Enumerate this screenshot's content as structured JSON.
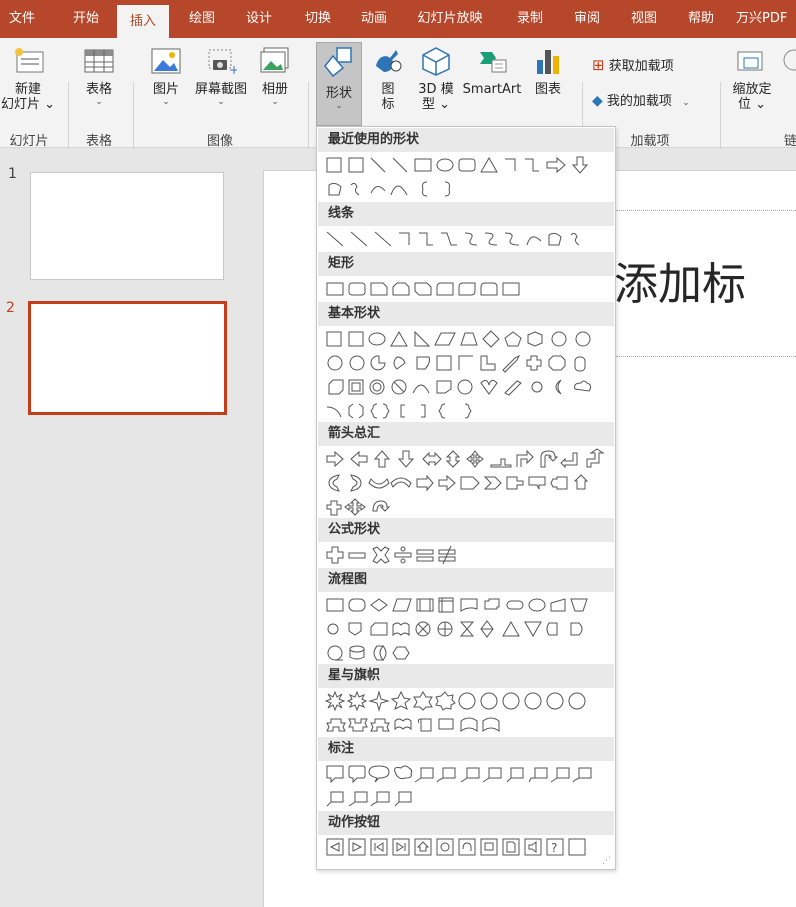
{
  "tabs": [
    {
      "label": "文件",
      "active": false
    },
    {
      "label": "开始",
      "active": false
    },
    {
      "label": "插入",
      "active": true
    },
    {
      "label": "绘图",
      "active": false
    },
    {
      "label": "设计",
      "active": false
    },
    {
      "label": "切换",
      "active": false
    },
    {
      "label": "动画",
      "active": false
    },
    {
      "label": "幻灯片放映",
      "active": false
    },
    {
      "label": "录制",
      "active": false
    },
    {
      "label": "审阅",
      "active": false
    },
    {
      "label": "视图",
      "active": false
    },
    {
      "label": "帮助",
      "active": false
    },
    {
      "label": "万兴PDF",
      "active": false
    }
  ],
  "ribbon": {
    "new_slide_line1": "新建",
    "new_slide_line2": "幻灯片 ⌄",
    "table": "表格",
    "picture": "图片",
    "screenshot": "屏幕截图",
    "album": "相册",
    "shapes": "形状",
    "icons_line1": "图",
    "icons_line2": "标",
    "model3d_line1": "3D 模",
    "model3d_line2": "型 ⌄",
    "smartart": "SmartArt",
    "chart": "图表",
    "get_addins": "获取加载项",
    "my_addins": "我的加载项",
    "zoom_line1": "缩放定",
    "zoom_line2": "位 ⌄",
    "links_cut": "链",
    "groups": {
      "slides": "幻灯片",
      "tables": "表格",
      "images": "图像",
      "addins": "加载项"
    },
    "accent": "#b7472a"
  },
  "gallery": {
    "sections": [
      {
        "title": "最近使用的形状"
      },
      {
        "title": "线条"
      },
      {
        "title": "矩形"
      },
      {
        "title": "基本形状"
      },
      {
        "title": "箭头总汇"
      },
      {
        "title": "公式形状"
      },
      {
        "title": "流程图"
      },
      {
        "title": "星与旗帜"
      },
      {
        "title": "标注"
      },
      {
        "title": "动作按钮"
      }
    ]
  },
  "slides": [
    {
      "number": "1",
      "selected": false
    },
    {
      "number": "2",
      "selected": true
    }
  ],
  "slide": {
    "title_placeholder": "添加标"
  }
}
